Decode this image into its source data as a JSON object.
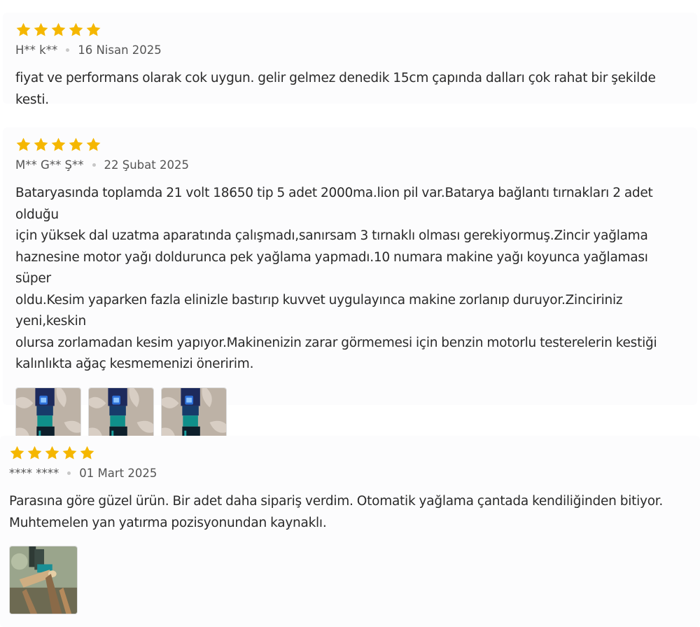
{
  "colors": {
    "star": "#f5b700",
    "text": "#2a2a2a",
    "meta": "#555555"
  },
  "reviews": [
    {
      "rating": 5,
      "author": "H** k**",
      "date": "16 Nisan 2025",
      "text": "fiyat ve performans olarak cok uygun. gelir gelmez denedik 15cm çapında dalları çok rahat bir şekilde kesti.",
      "images": []
    },
    {
      "rating": 5,
      "author": "M** G** Ş**",
      "date": "22 Şubat 2025",
      "text": "Bataryasında toplamda 21 volt 18650 tip 5 adet 2000ma.lion pil var.Batarya bağlantı tırnakları 2 adet olduğu\niçin yüksek dal uzatma aparatında çalışmadı,sanırsam 3 tırnaklı olması gerekiyormuş.Zincir yağlama\nhaznesine motor yağı doldurunca pek yağlama yapmadı.10 numara makine yağı koyunca yağlaması süper\noldu.Kesim yaparken fazla elinizle bastırıp kuvvet uygulayınca makine zorlanıp duruyor.Zinciriniz yeni,keskin\nolursa zorlamadan kesim yapıyor.Makinenizin zarar görmemesi için benzin motorlu testerelerin kestiği\nkalınlıkta ağaç kesmemenizi öneririm.",
      "images": [
        "review-photo",
        "review-photo",
        "review-photo"
      ]
    },
    {
      "rating": 5,
      "author": "**** ****",
      "date": "01 Mart 2025",
      "text": "Parasına göre güzel ürün. Bir adet daha sipariş verdim. Otomatik yağlama çantada kendiliğinden bitiyor.\nMuhtemelen yan yatırma pozisyonundan kaynaklı.",
      "images": [
        "review-photo"
      ]
    }
  ]
}
